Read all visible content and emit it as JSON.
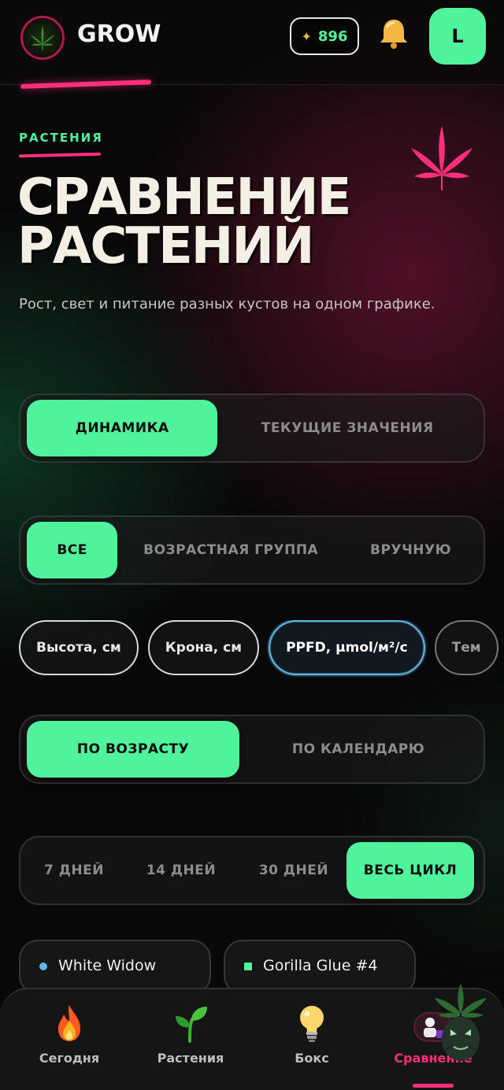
{
  "header": {
    "brand": "GROW",
    "coins": "896"
  },
  "hero": {
    "eyebrow": "РАСТЕНИЯ",
    "title_line1": "Сравнение",
    "title_line2": "растений",
    "subtitle": "Рост, свет и питание разных кустов на одном графике."
  },
  "view_toggle": {
    "options": [
      "Динамика",
      "Текущие значения"
    ],
    "selected": "Динамика"
  },
  "group_toggle": {
    "options": [
      "Все",
      "Возрастная группа",
      "Вручную"
    ],
    "selected": "Все"
  },
  "metrics": {
    "items": [
      "Высота, см",
      "Крона, см",
      "PPFD, μmol/м²/с",
      "Тем"
    ],
    "selected": "PPFD, μmol/м²/с"
  },
  "axis_toggle": {
    "options": [
      "По возрасту",
      "По календарю"
    ],
    "selected": "По возрасту"
  },
  "range_toggle": {
    "options": [
      "7 дней",
      "14 дней",
      "30 дней",
      "Весь цикл"
    ],
    "selected": "Весь цикл"
  },
  "plants": [
    {
      "name": "White Widow",
      "color": "#5fb6e6",
      "marker": "circle"
    },
    {
      "name": "Gorilla Glue #4",
      "color": "#4ff39c",
      "marker": "square"
    }
  ],
  "nav": {
    "items": [
      {
        "label": "Сегодня",
        "icon": "fire-icon"
      },
      {
        "label": "Растения",
        "icon": "sprout-icon"
      },
      {
        "label": "Бокс",
        "icon": "lightbulb-icon"
      },
      {
        "label": "Сравнение",
        "icon": "compare-icon"
      }
    ],
    "active": "Сравнение"
  },
  "colors": {
    "accent_green": "#4ff39c",
    "accent_pink": "#ff2f7a",
    "chip_active_border": "#5fb6e6"
  }
}
